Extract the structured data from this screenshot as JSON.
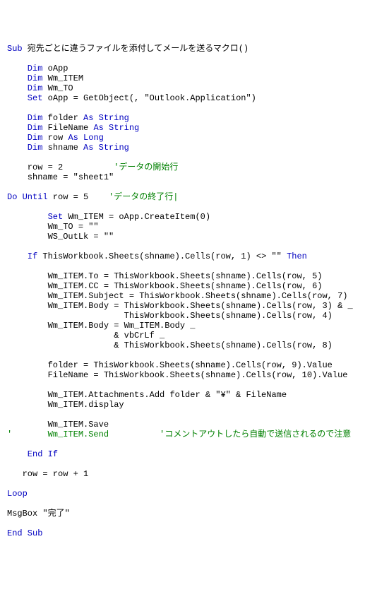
{
  "code": {
    "l01a": "Sub",
    "l01b": " 宛先ごとに違うファイルを添付してメールを送るマクロ()",
    "l02a": "    Dim",
    "l02b": " oApp",
    "l03a": "    Dim",
    "l03b": " Wm_ITEM",
    "l04a": "    Dim",
    "l04b": " Wm_TO",
    "l05a": "    Set",
    "l05b": " oApp = GetObject(, \"Outlook.Application\")",
    "l06a": "    Dim",
    "l06b": " folder ",
    "l06c": "As String",
    "l07a": "    Dim",
    "l07b": " FileName ",
    "l07c": "As String",
    "l08a": "    Dim",
    "l08b": " row ",
    "l08c": "As Long",
    "l09a": "    Dim",
    "l09b": " shname ",
    "l09c": "As String",
    "l10a": "    row = 2          ",
    "l10b": "'データの開始行",
    "l11a": "    shname = \"sheet1\"",
    "l12a": "Do Until",
    "l12b": " row = 5    ",
    "l12c": "'データの終了行|",
    "l13a": "        Set",
    "l13b": " Wm_ITEM = oApp.CreateItem(0)",
    "l14a": "        Wm_TO = \"\"",
    "l15a": "        WS_OutLk = \"\"",
    "l16a": "    If",
    "l16b": " ThisWorkbook.Sheets(shname).Cells(row, 1) <> \"\" ",
    "l16c": "Then",
    "l17a": "        Wm_ITEM.To = ThisWorkbook.Sheets(shname).Cells(row, 5)",
    "l18a": "        Wm_ITEM.CC = ThisWorkbook.Sheets(shname).Cells(row, 6)",
    "l19a": "        Wm_ITEM.Subject = ThisWorkbook.Sheets(shname).Cells(row, 7)",
    "l20a": "        Wm_ITEM.Body = ThisWorkbook.Sheets(shname).Cells(row, 3) & _",
    "l21a": "                       ThisWorkbook.Sheets(shname).Cells(row, 4)",
    "l22a": "        Wm_ITEM.Body = Wm_ITEM.Body _",
    "l23a": "                     & vbCrLf _",
    "l24a": "                     & ThisWorkbook.Sheets(shname).Cells(row, 8)",
    "l25a": "        folder = ThisWorkbook.Sheets(shname).Cells(row, 9).Value",
    "l26a": "        FileName = ThisWorkbook.Sheets(shname).Cells(row, 10).Value",
    "l27a": "        Wm_ITEM.Attachments.Add folder & \"¥\" & FileName",
    "l28a": "        Wm_ITEM.display",
    "l29a": "        Wm_ITEM.Save",
    "l30a": "'       Wm_ITEM.Send          'コメントアウトしたら自動で送信されるので注意",
    "l31a": "    End If",
    "l32a": "   row = row + 1",
    "l33a": "Loop",
    "l34a": "MsgBox \"完了\"",
    "l35a": "End Sub"
  }
}
